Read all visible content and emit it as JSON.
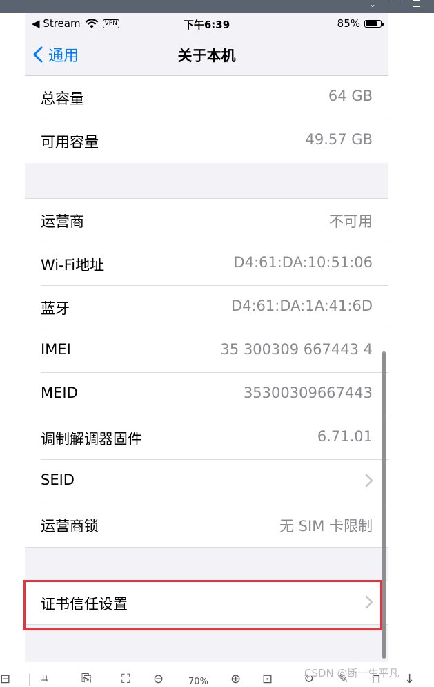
{
  "status_bar": {
    "carrier_label": "◀ Stream",
    "vpn_badge": "VPN",
    "time": "下午6:39",
    "battery_percent": "85%",
    "battery_level": 0.85
  },
  "nav": {
    "back_label": "通用",
    "title": "关于本机"
  },
  "storage": [
    {
      "label": "总容量",
      "value": "64 GB"
    },
    {
      "label": "可用容量",
      "value": "49.57 GB"
    }
  ],
  "details": [
    {
      "label": "运营商",
      "value": "不可用"
    },
    {
      "label": "Wi‑Fi地址",
      "value": "D4:61:DA:10:51:06"
    },
    {
      "label": "蓝牙",
      "value": "D4:61:DA:1A:41:6D"
    },
    {
      "label": "IMEI",
      "value": "35 300309 667443 4"
    },
    {
      "label": "MEID",
      "value": "35300309667443"
    },
    {
      "label": "调制解调器固件",
      "value": "6.71.01"
    },
    {
      "label": "SEID",
      "value": ""
    },
    {
      "label": "运营商锁",
      "value": "无 SIM 卡限制"
    }
  ],
  "trust": {
    "label": "证书信任设置"
  },
  "viewer": {
    "zoom_level": "70%",
    "watermark": "CSDN @断一生平凡"
  },
  "icons": [
    "chevron-left-icon",
    "wifi-icon",
    "battery-icon",
    "chevron-right-icon",
    "zoom-in-icon",
    "zoom-out-icon"
  ],
  "colors": {
    "accent": "#007aff",
    "highlight": "#e8333c",
    "secondary_text": "#8a8a8e",
    "background": "#f2f2f7"
  }
}
